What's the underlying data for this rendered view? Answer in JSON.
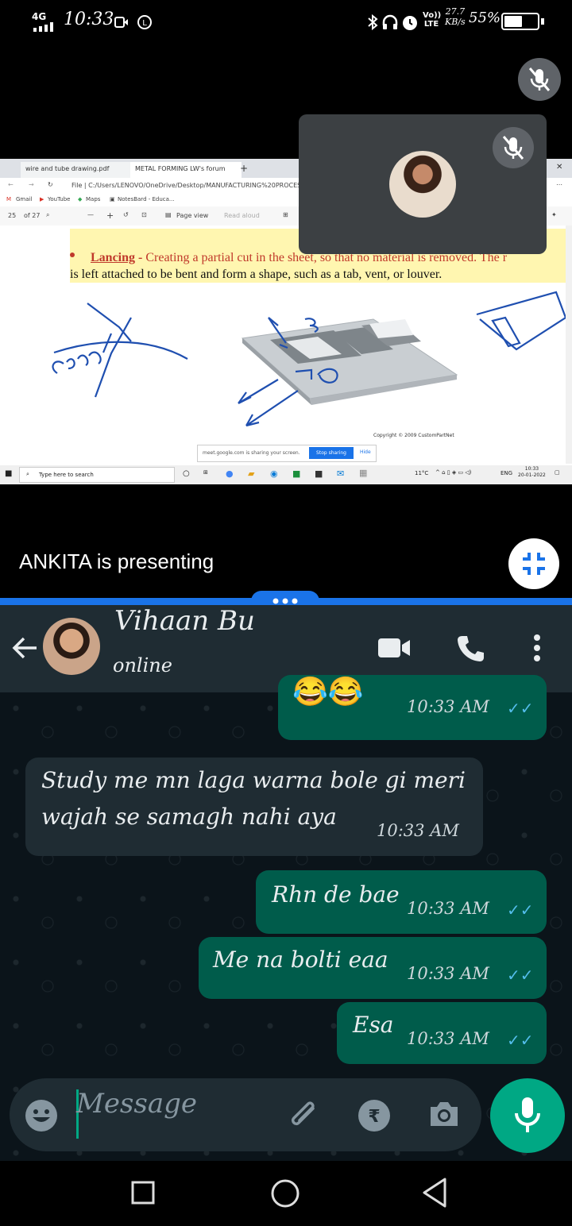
{
  "status_bar": {
    "network": "4G",
    "time": "10:33",
    "speed_value": "27.7",
    "speed_unit": "KB/s",
    "volte": "Vo)) LTE",
    "battery_pct": "55%",
    "battery_level": 0.55
  },
  "screen_share": {
    "tabs": [
      "wire and tube drawing.pdf",
      "METAL FORMING LW's forum"
    ],
    "address": "File  |  C:/Users/LENOVO/OneDrive/Desktop/MANUFACTURING%20PROCESS%",
    "bookmarks": [
      "Gmail",
      "YouTube",
      "Maps",
      "NotesBard - Educa..."
    ],
    "pdf_page": "of 27",
    "pdf_view": "Page view",
    "pdf_read": "Read aloud",
    "lancing_keyword": "Lancing",
    "lancing_dash": " - ",
    "lancing_text_1": "Creating a partial cut in the sheet, so that no material is removed. The r",
    "lancing_text_2": "is left attached to be bent and form a shape, such as a tab, vent, or louver.",
    "copyright": "Copyright © 2009 CustomPartNet",
    "share_notice": "meet.google.com is sharing your screen.",
    "stop_sharing": "Stop sharing",
    "hide": "Hide",
    "taskbar_search": "Type here to search",
    "weather": "11°C",
    "lang": "ENG",
    "clock_time": "10:33",
    "clock_date": "20-01-2022"
  },
  "meet": {
    "presenting": "ANKITA is presenting"
  },
  "chat": {
    "contact_name": "Vihaan Bu",
    "contact_status": "online",
    "messages": [
      {
        "dir": "out",
        "text": "😂😂",
        "time": "10:33 AM",
        "ticks": "✓✓"
      },
      {
        "dir": "in",
        "text_line1": "Study me mn laga warna bole gi meri",
        "text_line2": "wajah se samagh nahi aya",
        "time": "10:33 AM"
      },
      {
        "dir": "out",
        "text": "Rhn de bae",
        "time": "10:33 AM",
        "ticks": "✓✓"
      },
      {
        "dir": "out",
        "text": "Me na bolti eaa",
        "time": "10:33 AM",
        "ticks": "✓✓"
      },
      {
        "dir": "out",
        "text": "Esa",
        "time": "10:33 AM",
        "ticks": "✓✓"
      }
    ],
    "input_placeholder": "Message"
  },
  "colors": {
    "wa_bg": "#0b141a",
    "wa_out": "#005c4b",
    "wa_in": "#1f2c33",
    "wa_accent": "#00a884",
    "meet_blue": "#1a73e8"
  }
}
